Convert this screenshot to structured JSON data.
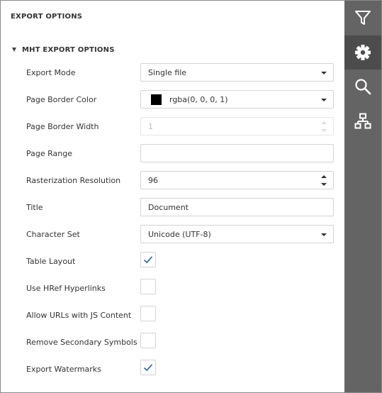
{
  "panel": {
    "title": "EXPORT OPTIONS",
    "section": {
      "label": "MHT EXPORT OPTIONS",
      "expanded": true
    }
  },
  "fields": {
    "export_mode": {
      "label": "Export Mode",
      "value": "Single file"
    },
    "page_border_color": {
      "label": "Page Border Color",
      "value": "rgba(0, 0, 0, 1)",
      "swatch_color": "#000000"
    },
    "page_border_width": {
      "label": "Page Border Width",
      "value": "1",
      "disabled": true
    },
    "page_range": {
      "label": "Page Range",
      "value": ""
    },
    "rasterization_resolution": {
      "label": "Rasterization Resolution",
      "value": "96"
    },
    "title": {
      "label": "Title",
      "value": "Document"
    },
    "character_set": {
      "label": "Character Set",
      "value": "Unicode (UTF-8)"
    },
    "table_layout": {
      "label": "Table Layout",
      "checked": true
    },
    "use_href_hyperlinks": {
      "label": "Use HRef Hyperlinks",
      "checked": false
    },
    "allow_urls_js": {
      "label": "Allow URLs with JS Content",
      "checked": false
    },
    "remove_secondary_symbols": {
      "label": "Remove Secondary Symbols",
      "checked": false
    },
    "export_watermarks": {
      "label": "Export Watermarks",
      "checked": true
    }
  },
  "sidebar": {
    "items": [
      {
        "icon": "filter-icon",
        "active": false
      },
      {
        "icon": "gear-icon",
        "active": true
      },
      {
        "icon": "search-icon",
        "active": false
      },
      {
        "icon": "document-map-icon",
        "active": false
      }
    ]
  },
  "colors": {
    "sidebar_bg": "#646464",
    "sidebar_active_bg": "#4c4c4c",
    "checkmark": "#3b6e9e",
    "editor_border": "#d4d4d4"
  }
}
